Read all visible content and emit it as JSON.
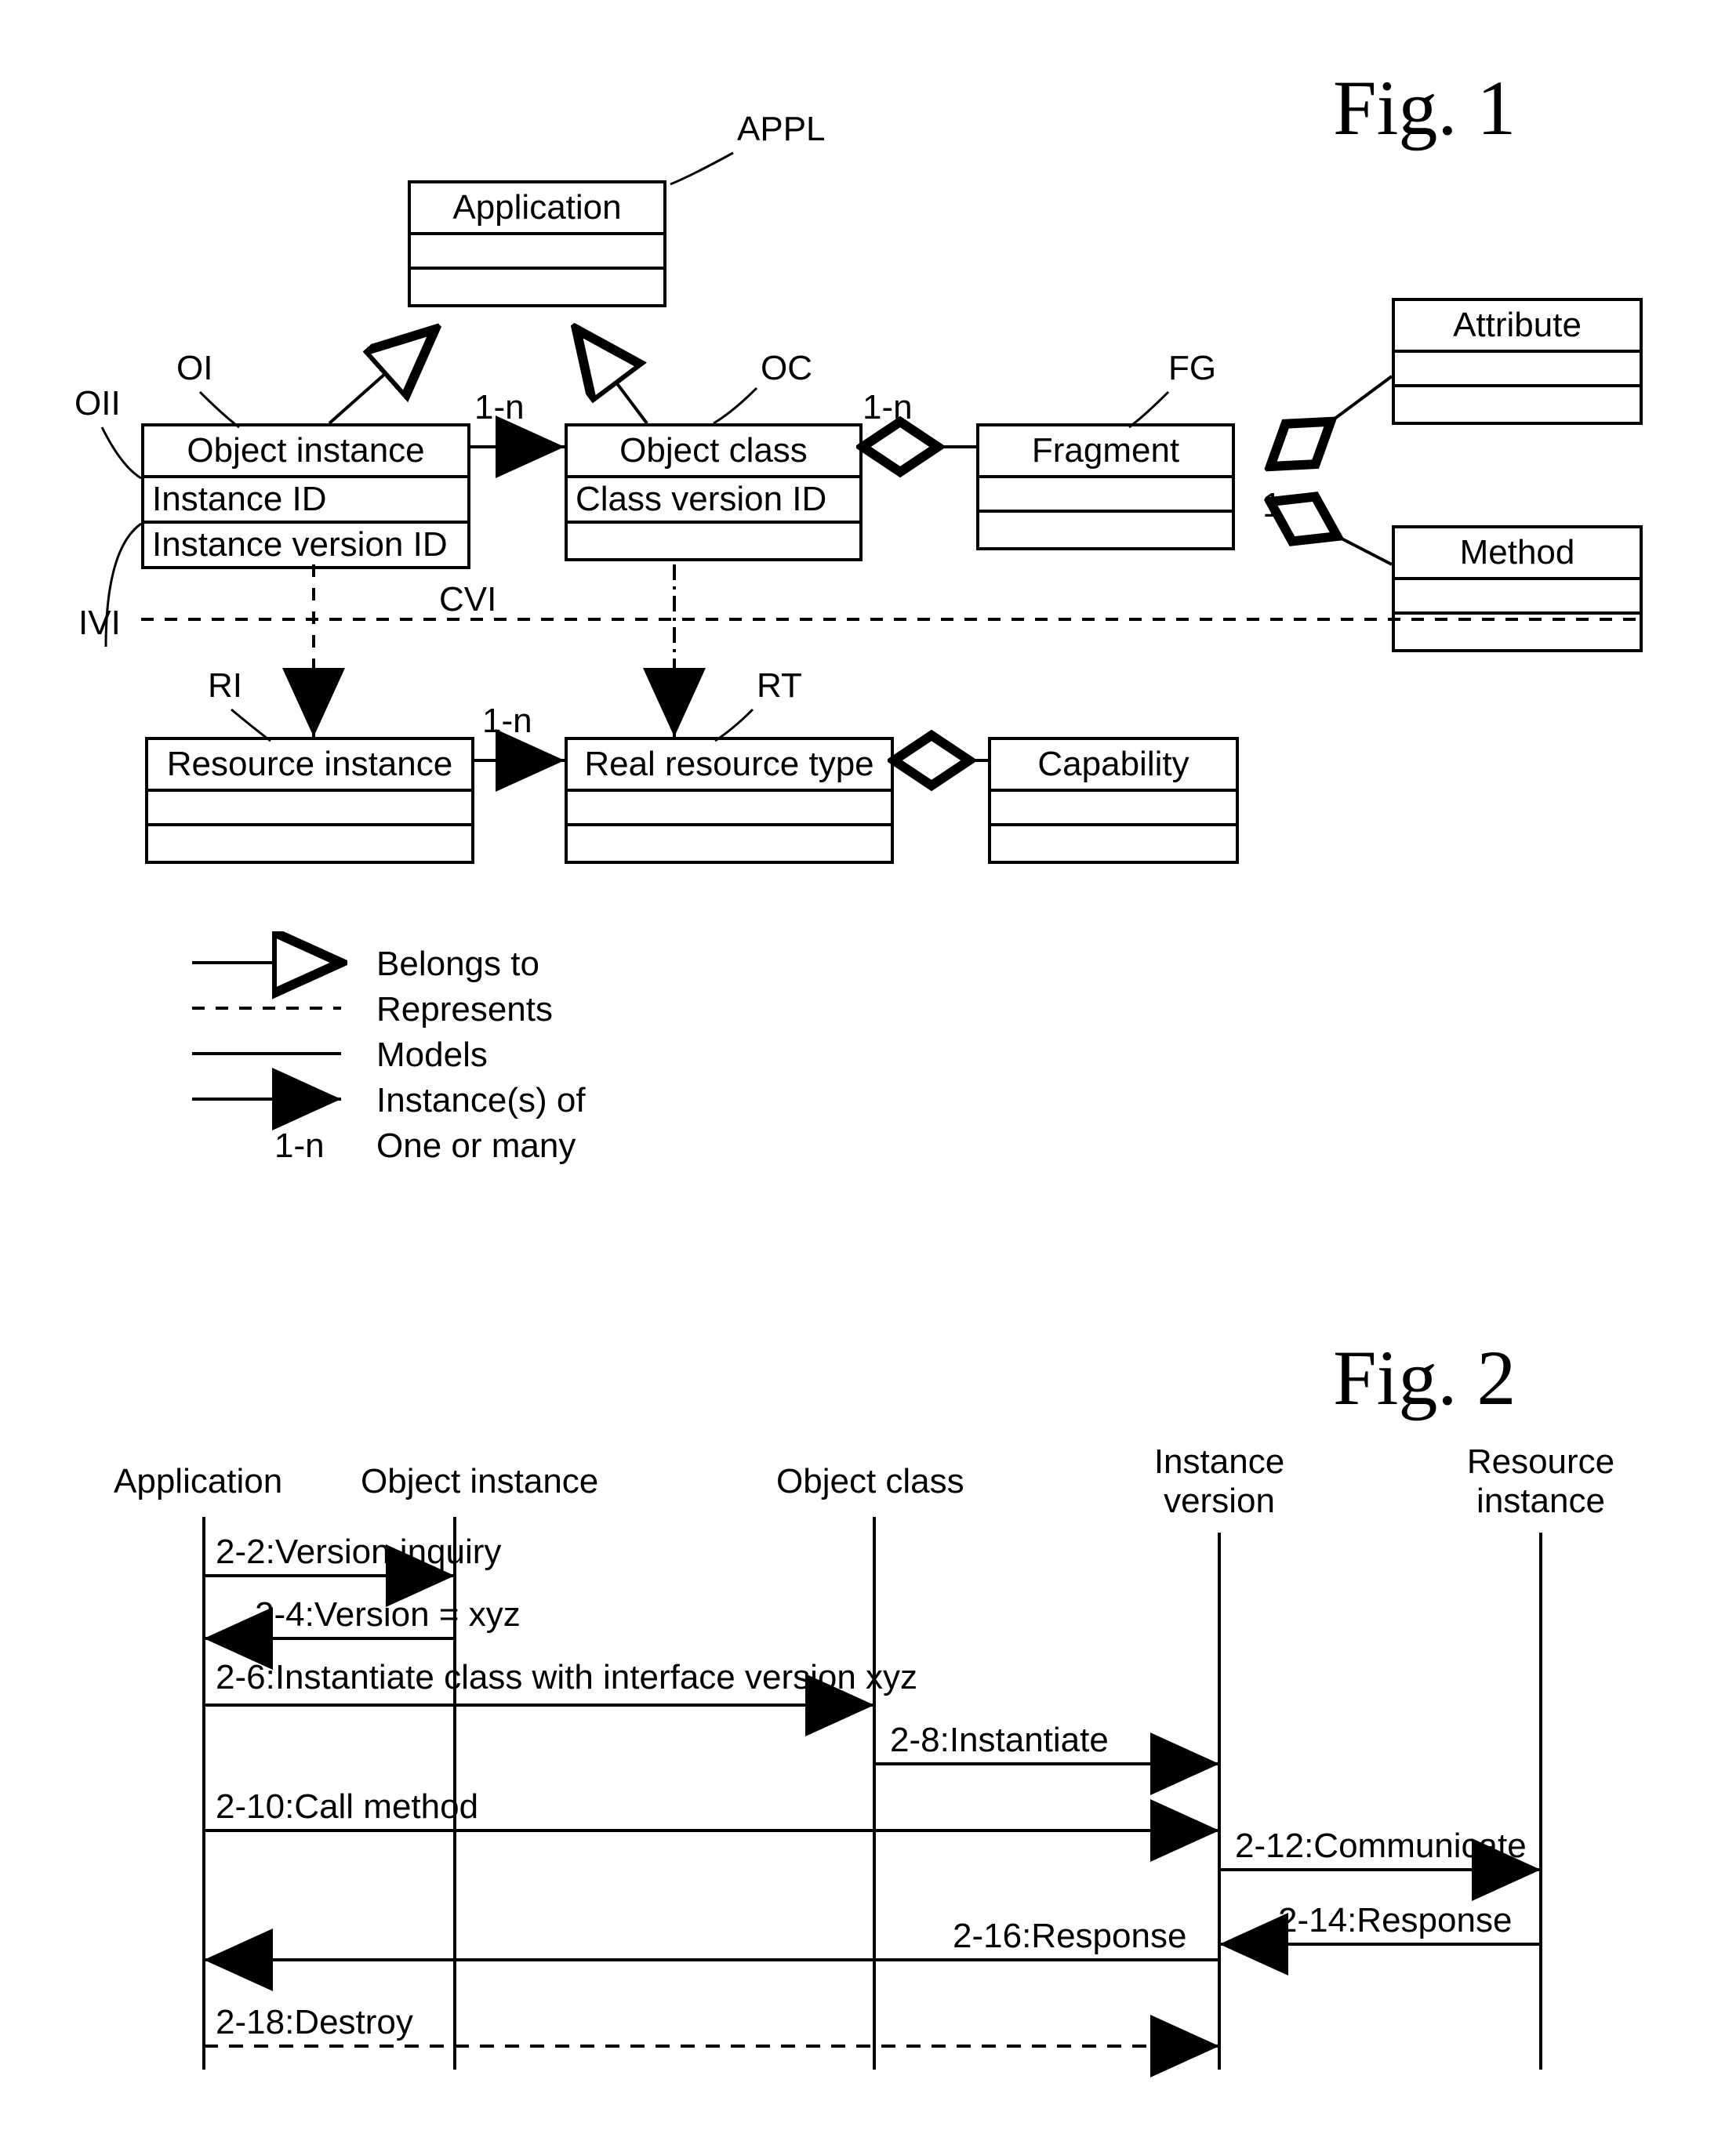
{
  "fig1": {
    "caption": "Fig. 1",
    "boxes": {
      "appl": {
        "title": "Application",
        "rows": [
          "",
          ""
        ]
      },
      "oi": {
        "title": "Object instance",
        "rows": [
          "Instance ID",
          "Instance version ID"
        ]
      },
      "oc": {
        "title": "Object class",
        "rows": [
          "Class version ID",
          ""
        ]
      },
      "fg": {
        "title": "Fragment",
        "rows": [
          "",
          ""
        ]
      },
      "attr": {
        "title": "Attribute",
        "rows": [
          "",
          ""
        ]
      },
      "meth": {
        "title": "Method",
        "rows": [
          "",
          ""
        ]
      },
      "ri": {
        "title": "Resource instance",
        "rows": [
          "",
          ""
        ]
      },
      "rt": {
        "title": "Real resource type",
        "rows": [
          "",
          ""
        ]
      },
      "cap": {
        "title": "Capability",
        "rows": [
          "",
          ""
        ]
      }
    },
    "labels": {
      "APPL": "APPL",
      "OI": "OI",
      "OII": "OII",
      "IVI": "IVI",
      "CVI": "CVI",
      "OC": "OC",
      "FG": "FG",
      "RI": "RI",
      "RT": "RT",
      "n1": "1-n",
      "n2": "1-n",
      "n3": "1-n",
      "n4": "1-n"
    },
    "legend": {
      "belongs_to": "Belongs to",
      "represents": "Represents",
      "models": "Models",
      "instances_of": "Instance(s) of",
      "one_or_many": "One or many",
      "one_or_many_sym": "1-n"
    }
  },
  "fig2": {
    "caption": "Fig. 2",
    "lifelines": {
      "l1": "Application",
      "l2": "Object instance",
      "l3": "Object class",
      "l4": "Instance version",
      "l5": "Resource instance"
    },
    "messages": {
      "m22": "2-2:Version inquiry",
      "m24": "2-4:Version = xyz",
      "m26": "2-6:Instantiate class with interface version xyz",
      "m28": "2-8:Instantiate",
      "m210": "2-10:Call method",
      "m212": "2-12:Communicate",
      "m214": "2-14:Response",
      "m216": "2-16:Response",
      "m218": "2-18:Destroy"
    }
  }
}
